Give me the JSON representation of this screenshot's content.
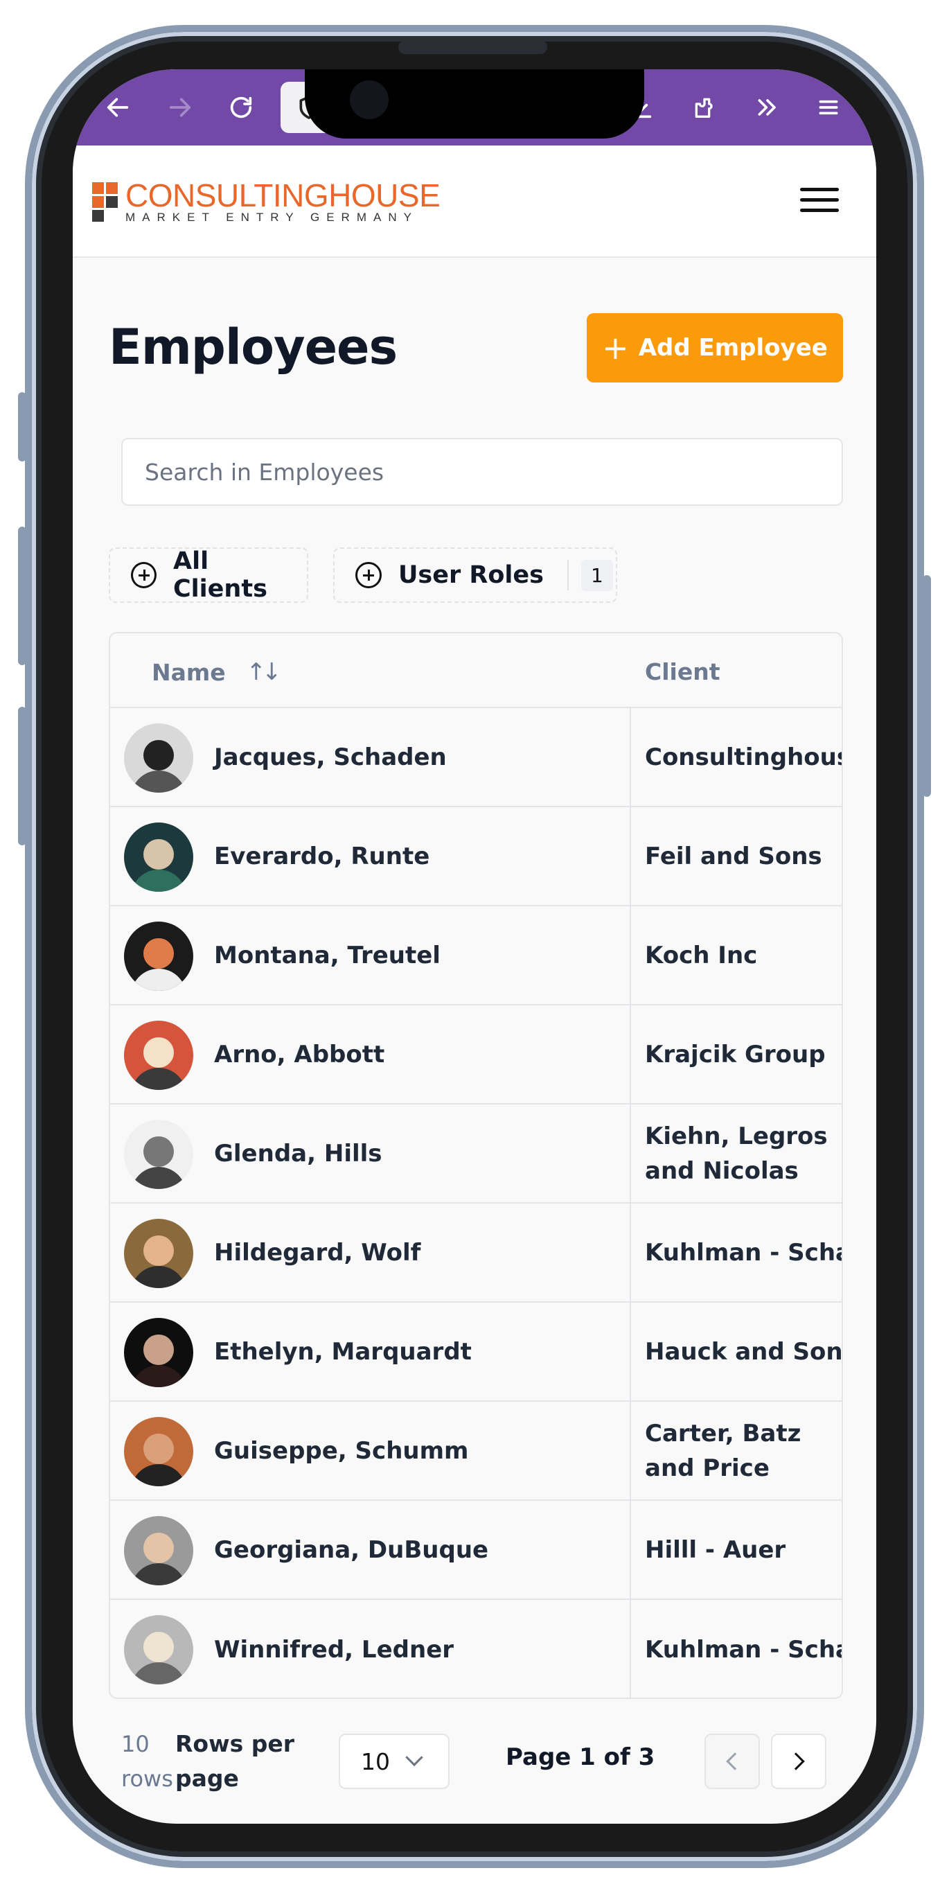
{
  "browser": {
    "icons": [
      "back-arrow-icon",
      "forward-arrow-icon",
      "reload-icon",
      "shield-icon",
      "download-icon",
      "extensions-icon",
      "more-tools-icon",
      "hamburger-menu-icon"
    ],
    "toolbar_color": "#7249a6"
  },
  "brand": {
    "name": "CONSULTINGHOUSE",
    "tagline": "MARKET ENTRY GERMANY",
    "accent_color": "#e8672a"
  },
  "page": {
    "title": "Employees",
    "add_button_label": "Add Employee",
    "add_button_color": "#fb9b0c"
  },
  "search": {
    "placeholder": "Search in Employees",
    "value": ""
  },
  "filters": {
    "clients_label": "All Clients",
    "roles_label": "User Roles",
    "roles_count": "1"
  },
  "table": {
    "columns": [
      "Name",
      "Client"
    ],
    "rows": [
      {
        "name": "Jacques, Schaden",
        "client": "Consultinghouse"
      },
      {
        "name": "Everardo, Runte",
        "client": "Feil and Sons"
      },
      {
        "name": "Montana, Treutel",
        "client": "Koch Inc"
      },
      {
        "name": "Arno, Abbott",
        "client": "Krajcik Group"
      },
      {
        "name": "Glenda, Hills",
        "client": "Kiehn, Legros and Nicolas"
      },
      {
        "name": "Hildegard, Wolf",
        "client": "Kuhlman - Schaefer"
      },
      {
        "name": "Ethelyn, Marquardt",
        "client": "Hauck and Sons"
      },
      {
        "name": "Guiseppe, Schumm",
        "client": "Carter, Batz and Price"
      },
      {
        "name": "Georgiana, DuBuque",
        "client": "Hilll - Auer"
      },
      {
        "name": "Winnifred, Ledner",
        "client": "Kuhlman - Schaefer"
      }
    ]
  },
  "pagination": {
    "rows_count": "10 rows",
    "rows_per_page_label": "Rows per page",
    "rows_per_page_value": "10",
    "page_info": "Page 1 of 3"
  }
}
